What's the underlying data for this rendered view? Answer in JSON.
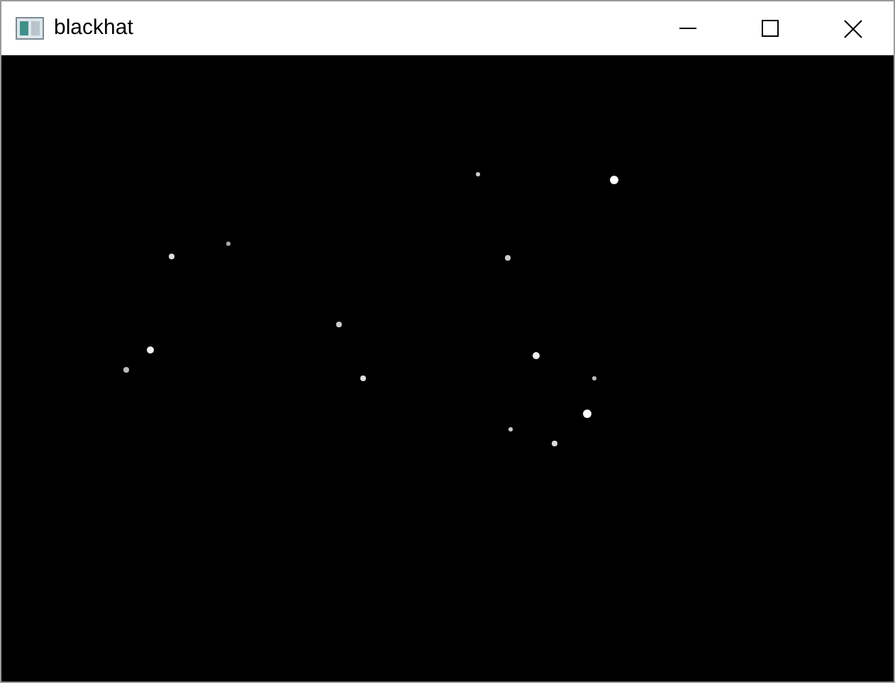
{
  "window": {
    "title": "blackhat"
  }
}
